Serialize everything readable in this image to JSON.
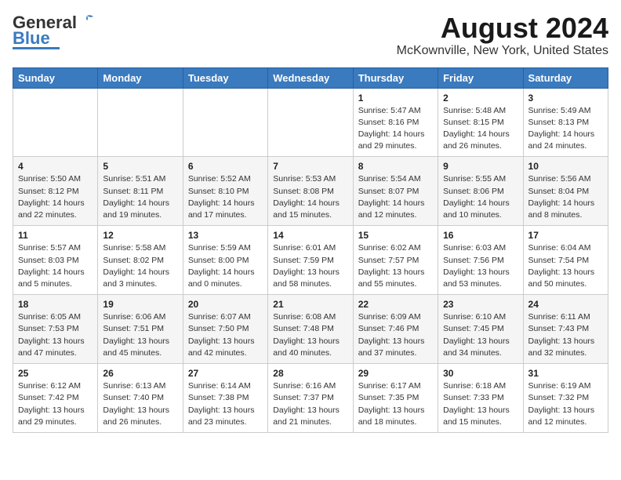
{
  "logo": {
    "general": "General",
    "blue": "Blue"
  },
  "title": "August 2024",
  "subtitle": "McKownville, New York, United States",
  "days_of_week": [
    "Sunday",
    "Monday",
    "Tuesday",
    "Wednesday",
    "Thursday",
    "Friday",
    "Saturday"
  ],
  "weeks": [
    [
      {
        "day": "",
        "info": ""
      },
      {
        "day": "",
        "info": ""
      },
      {
        "day": "",
        "info": ""
      },
      {
        "day": "",
        "info": ""
      },
      {
        "day": "1",
        "info": "Sunrise: 5:47 AM\nSunset: 8:16 PM\nDaylight: 14 hours\nand 29 minutes."
      },
      {
        "day": "2",
        "info": "Sunrise: 5:48 AM\nSunset: 8:15 PM\nDaylight: 14 hours\nand 26 minutes."
      },
      {
        "day": "3",
        "info": "Sunrise: 5:49 AM\nSunset: 8:13 PM\nDaylight: 14 hours\nand 24 minutes."
      }
    ],
    [
      {
        "day": "4",
        "info": "Sunrise: 5:50 AM\nSunset: 8:12 PM\nDaylight: 14 hours\nand 22 minutes."
      },
      {
        "day": "5",
        "info": "Sunrise: 5:51 AM\nSunset: 8:11 PM\nDaylight: 14 hours\nand 19 minutes."
      },
      {
        "day": "6",
        "info": "Sunrise: 5:52 AM\nSunset: 8:10 PM\nDaylight: 14 hours\nand 17 minutes."
      },
      {
        "day": "7",
        "info": "Sunrise: 5:53 AM\nSunset: 8:08 PM\nDaylight: 14 hours\nand 15 minutes."
      },
      {
        "day": "8",
        "info": "Sunrise: 5:54 AM\nSunset: 8:07 PM\nDaylight: 14 hours\nand 12 minutes."
      },
      {
        "day": "9",
        "info": "Sunrise: 5:55 AM\nSunset: 8:06 PM\nDaylight: 14 hours\nand 10 minutes."
      },
      {
        "day": "10",
        "info": "Sunrise: 5:56 AM\nSunset: 8:04 PM\nDaylight: 14 hours\nand 8 minutes."
      }
    ],
    [
      {
        "day": "11",
        "info": "Sunrise: 5:57 AM\nSunset: 8:03 PM\nDaylight: 14 hours\nand 5 minutes."
      },
      {
        "day": "12",
        "info": "Sunrise: 5:58 AM\nSunset: 8:02 PM\nDaylight: 14 hours\nand 3 minutes."
      },
      {
        "day": "13",
        "info": "Sunrise: 5:59 AM\nSunset: 8:00 PM\nDaylight: 14 hours\nand 0 minutes."
      },
      {
        "day": "14",
        "info": "Sunrise: 6:01 AM\nSunset: 7:59 PM\nDaylight: 13 hours\nand 58 minutes."
      },
      {
        "day": "15",
        "info": "Sunrise: 6:02 AM\nSunset: 7:57 PM\nDaylight: 13 hours\nand 55 minutes."
      },
      {
        "day": "16",
        "info": "Sunrise: 6:03 AM\nSunset: 7:56 PM\nDaylight: 13 hours\nand 53 minutes."
      },
      {
        "day": "17",
        "info": "Sunrise: 6:04 AM\nSunset: 7:54 PM\nDaylight: 13 hours\nand 50 minutes."
      }
    ],
    [
      {
        "day": "18",
        "info": "Sunrise: 6:05 AM\nSunset: 7:53 PM\nDaylight: 13 hours\nand 47 minutes."
      },
      {
        "day": "19",
        "info": "Sunrise: 6:06 AM\nSunset: 7:51 PM\nDaylight: 13 hours\nand 45 minutes."
      },
      {
        "day": "20",
        "info": "Sunrise: 6:07 AM\nSunset: 7:50 PM\nDaylight: 13 hours\nand 42 minutes."
      },
      {
        "day": "21",
        "info": "Sunrise: 6:08 AM\nSunset: 7:48 PM\nDaylight: 13 hours\nand 40 minutes."
      },
      {
        "day": "22",
        "info": "Sunrise: 6:09 AM\nSunset: 7:46 PM\nDaylight: 13 hours\nand 37 minutes."
      },
      {
        "day": "23",
        "info": "Sunrise: 6:10 AM\nSunset: 7:45 PM\nDaylight: 13 hours\nand 34 minutes."
      },
      {
        "day": "24",
        "info": "Sunrise: 6:11 AM\nSunset: 7:43 PM\nDaylight: 13 hours\nand 32 minutes."
      }
    ],
    [
      {
        "day": "25",
        "info": "Sunrise: 6:12 AM\nSunset: 7:42 PM\nDaylight: 13 hours\nand 29 minutes."
      },
      {
        "day": "26",
        "info": "Sunrise: 6:13 AM\nSunset: 7:40 PM\nDaylight: 13 hours\nand 26 minutes."
      },
      {
        "day": "27",
        "info": "Sunrise: 6:14 AM\nSunset: 7:38 PM\nDaylight: 13 hours\nand 23 minutes."
      },
      {
        "day": "28",
        "info": "Sunrise: 6:16 AM\nSunset: 7:37 PM\nDaylight: 13 hours\nand 21 minutes."
      },
      {
        "day": "29",
        "info": "Sunrise: 6:17 AM\nSunset: 7:35 PM\nDaylight: 13 hours\nand 18 minutes."
      },
      {
        "day": "30",
        "info": "Sunrise: 6:18 AM\nSunset: 7:33 PM\nDaylight: 13 hours\nand 15 minutes."
      },
      {
        "day": "31",
        "info": "Sunrise: 6:19 AM\nSunset: 7:32 PM\nDaylight: 13 hours\nand 12 minutes."
      }
    ]
  ]
}
